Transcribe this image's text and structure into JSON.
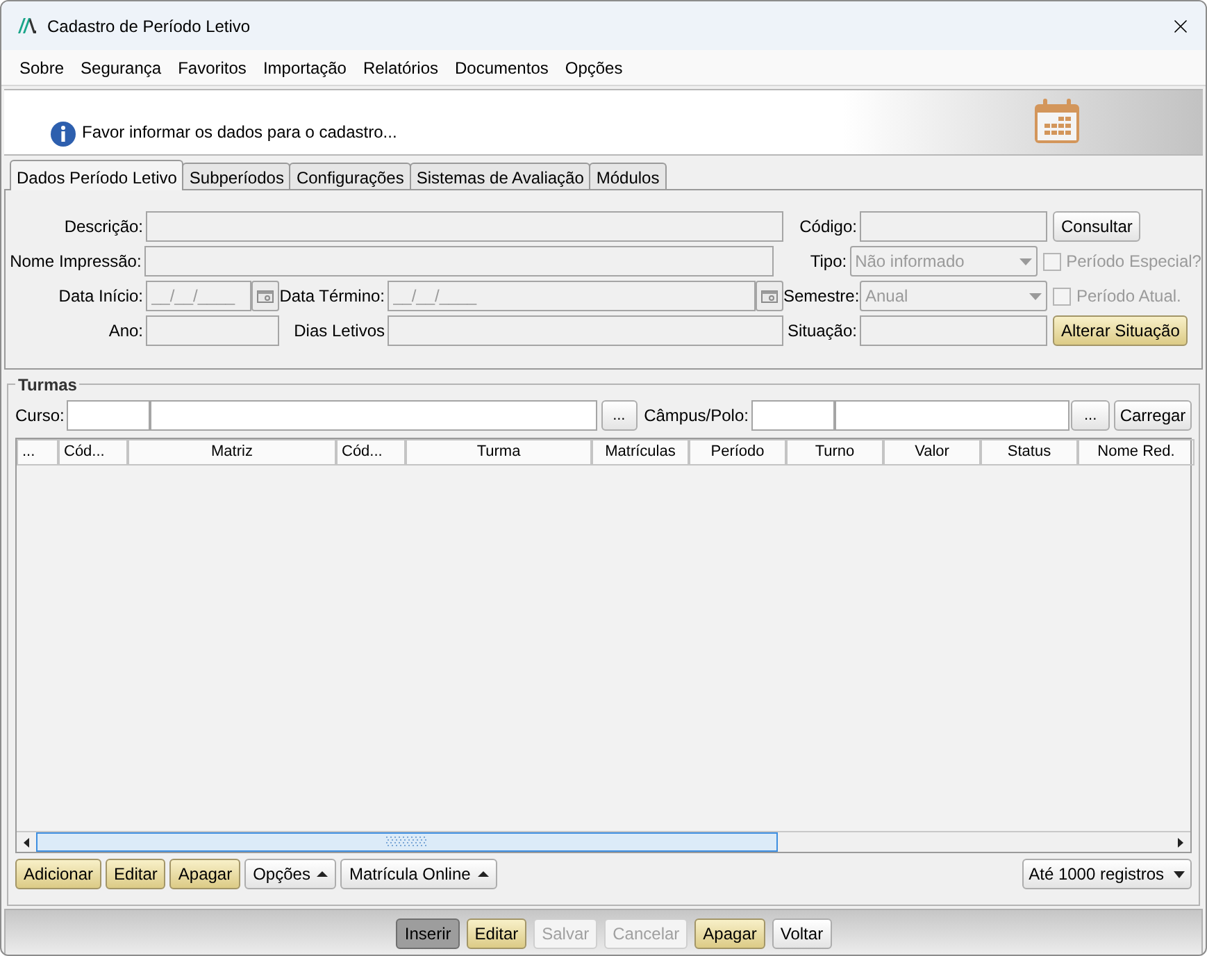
{
  "window": {
    "title": "Cadastro de Período Letivo"
  },
  "menu": [
    "Sobre",
    "Segurança",
    "Favoritos",
    "Importação",
    "Relatórios",
    "Documentos",
    "Opções"
  ],
  "banner": {
    "message": "Favor informar os dados para o cadastro..."
  },
  "tabs": [
    {
      "label": "Dados Período Letivo",
      "selected": true
    },
    {
      "label": "Subperíodos",
      "selected": false
    },
    {
      "label": "Configurações",
      "selected": false
    },
    {
      "label": "Sistemas de Avaliação",
      "selected": false
    },
    {
      "label": "Módulos",
      "selected": false
    }
  ],
  "form": {
    "descricao": {
      "label": "Descrição:"
    },
    "nome_impressao": {
      "label": "Nome Impressão:"
    },
    "data_inicio": {
      "label": "Data Início:",
      "placeholder": "__/__/____"
    },
    "data_termino": {
      "label": "Data Término:",
      "placeholder": "__/__/____"
    },
    "ano": {
      "label": "Ano:"
    },
    "dias_letivos": {
      "label": "Dias Letivos"
    },
    "codigo": {
      "label": "Código:"
    },
    "consultar_button": {
      "label": "Consultar",
      "kind": "plain",
      "disabled": false
    },
    "tipo": {
      "label": "Tipo:",
      "value": "Não informado",
      "disabled": true
    },
    "periodo_especial": {
      "label": "Período Especial?",
      "checked": false,
      "disabled": true
    },
    "semestre": {
      "label": "Semestre:",
      "value": "Anual",
      "disabled": true
    },
    "periodo_atual": {
      "label": "Período Atual.",
      "checked": false,
      "disabled": true
    },
    "situacao": {
      "label": "Situação:"
    },
    "alterar_button": {
      "label": "Alterar Situação",
      "kind": "gold",
      "disabled": false
    }
  },
  "turmas": {
    "title": "Turmas",
    "curso_label": "Curso:",
    "curso_browse": "...",
    "campus_label": "Câmpus/Polo:",
    "campus_browse": "...",
    "load_button": "Carregar",
    "table": {
      "columns": [
        "...",
        "Cód...",
        "Matriz",
        "Cód...",
        "Turma",
        "Matrículas",
        "Período",
        "Turno",
        "Valor",
        "Status",
        "Nome Red."
      ]
    },
    "actions": [
      {
        "label": "Adicionar",
        "kind": "gold"
      },
      {
        "label": "Editar",
        "kind": "gold"
      },
      {
        "label": "Apagar",
        "kind": "gold"
      },
      {
        "label": "Opções",
        "kind": "menu"
      },
      {
        "label": "Matrícula Online",
        "kind": "menu"
      }
    ],
    "limit_select": "Até 1000 registros"
  },
  "footer_buttons": [
    {
      "label": "Inserir",
      "kind": "pressed",
      "disabled": false
    },
    {
      "label": "Editar",
      "kind": "gold",
      "disabled": false
    },
    {
      "label": "Salvar",
      "kind": "plain",
      "disabled": true
    },
    {
      "label": "Cancelar",
      "kind": "plain",
      "disabled": true
    },
    {
      "label": "Apagar",
      "kind": "gold",
      "disabled": false
    },
    {
      "label": "Voltar",
      "kind": "plain",
      "disabled": false
    }
  ]
}
